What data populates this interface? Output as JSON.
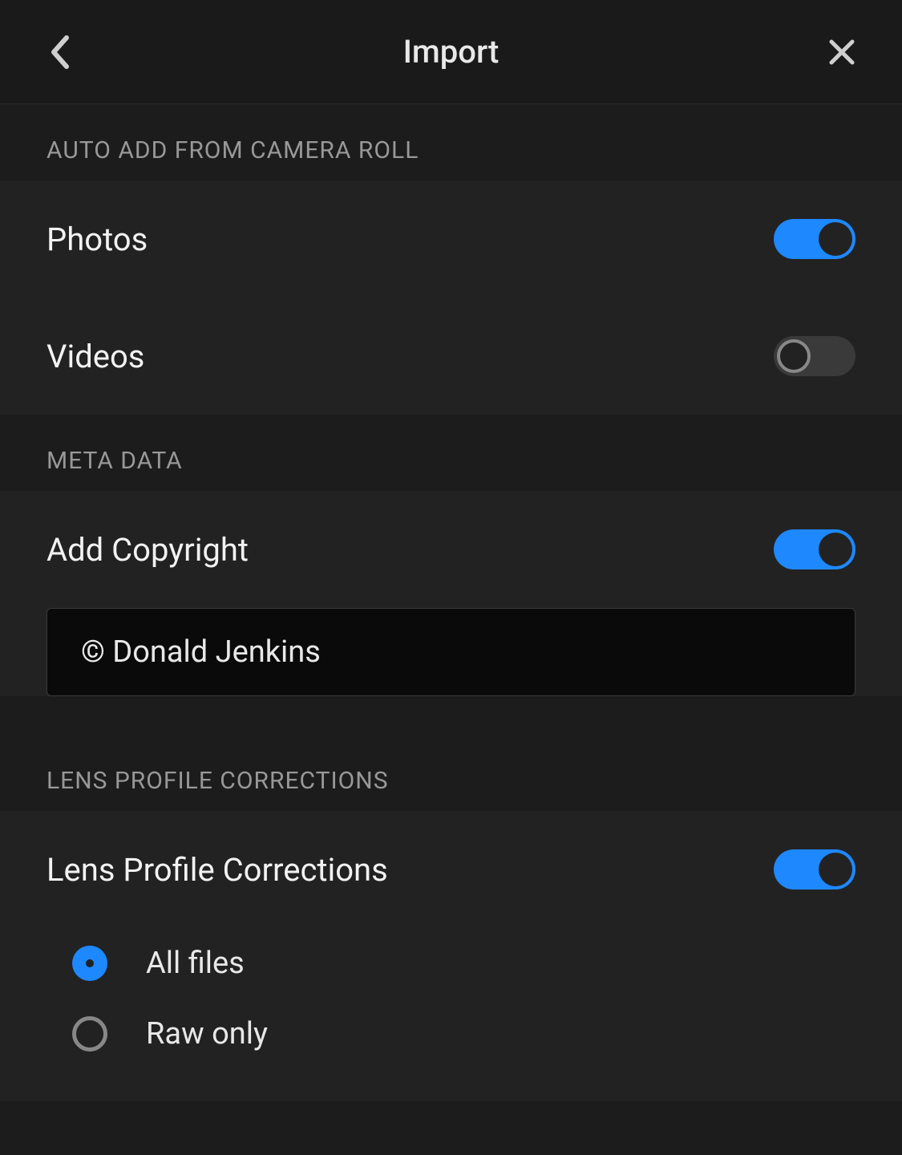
{
  "header": {
    "title": "Import"
  },
  "sections": {
    "auto_add": {
      "header": "AUTO ADD FROM CAMERA ROLL",
      "photos_label": "Photos",
      "photos_on": true,
      "videos_label": "Videos",
      "videos_on": false
    },
    "metadata": {
      "header": "META DATA",
      "copyright_label": "Add Copyright",
      "copyright_on": true,
      "copyright_value": "© Donald Jenkins"
    },
    "lens": {
      "header": "LENS PROFILE CORRECTIONS",
      "corrections_label": "Lens Profile Corrections",
      "corrections_on": true,
      "options": {
        "all_files": "All files",
        "raw_only": "Raw only"
      },
      "selected": "all_files"
    }
  }
}
